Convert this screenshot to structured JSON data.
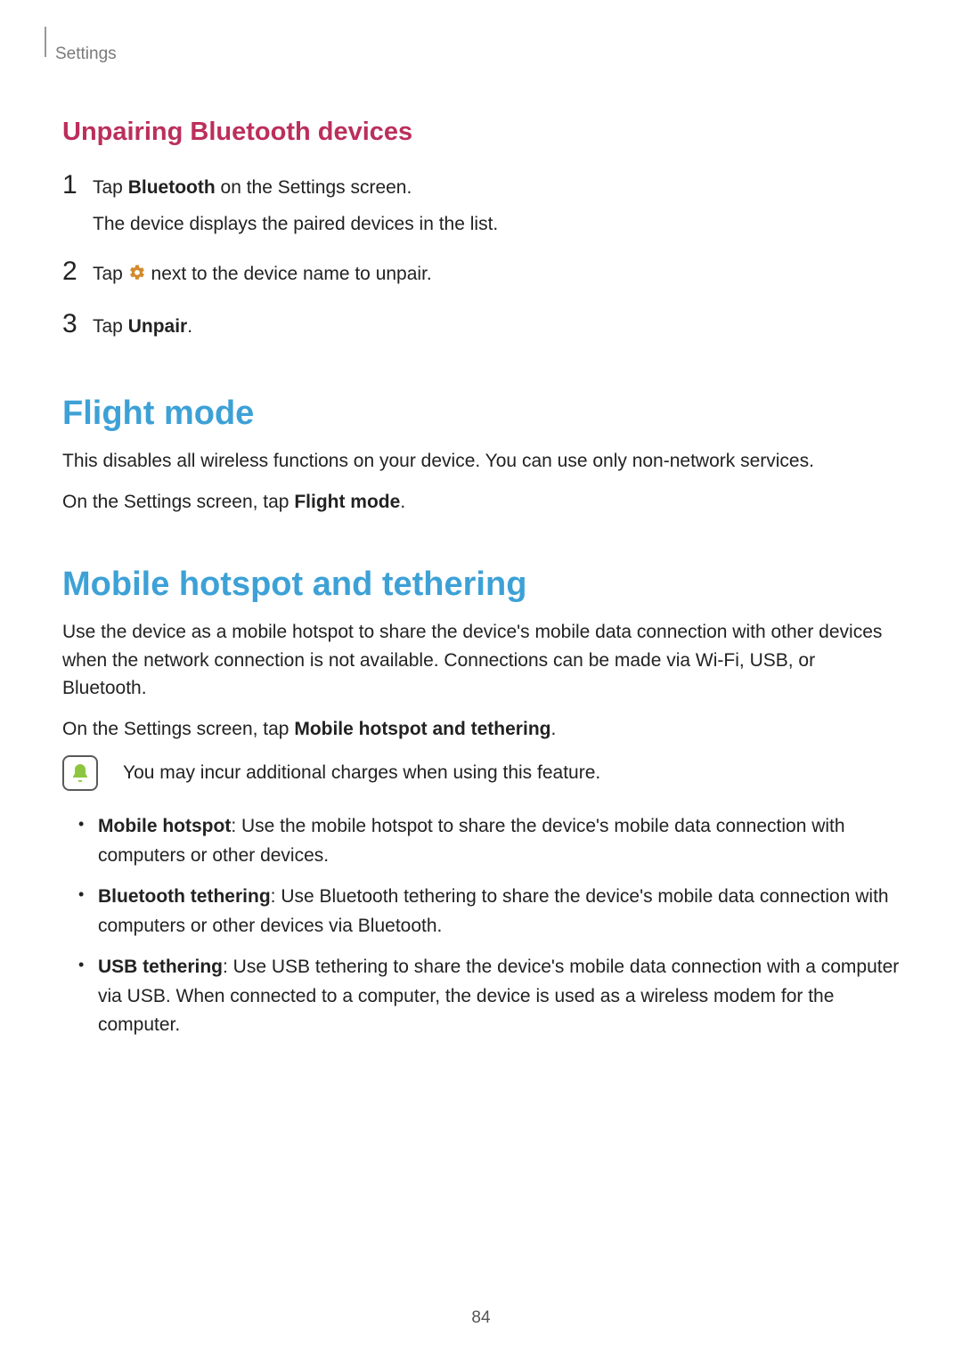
{
  "header": {
    "section": "Settings"
  },
  "unpairing": {
    "title": "Unpairing Bluetooth devices",
    "steps": {
      "s1": {
        "num": "1",
        "prefix": "Tap ",
        "bold": "Bluetooth",
        "suffix": " on the Settings screen.",
        "sub": "The device displays the paired devices in the list."
      },
      "s2": {
        "num": "2",
        "prefix": "Tap ",
        "suffix": " next to the device name to unpair."
      },
      "s3": {
        "num": "3",
        "prefix": "Tap ",
        "bold": "Unpair",
        "suffix": "."
      }
    }
  },
  "flight": {
    "title": "Flight mode",
    "p1": "This disables all wireless functions on your device. You can use only non-network services.",
    "p2_prefix": "On the Settings screen, tap ",
    "p2_bold": "Flight mode",
    "p2_suffix": "."
  },
  "hotspot": {
    "title": "Mobile hotspot and tethering",
    "p1": "Use the device as a mobile hotspot to share the device's mobile data connection with other devices when the network connection is not available. Connections can be made via Wi-Fi, USB, or Bluetooth.",
    "p2_prefix": "On the Settings screen, tap ",
    "p2_bold": "Mobile hotspot and tethering",
    "p2_suffix": ".",
    "note": "You may incur additional charges when using this feature.",
    "bullets": {
      "b1": {
        "bold": "Mobile hotspot",
        "text": ": Use the mobile hotspot to share the device's mobile data connection with computers or other devices."
      },
      "b2": {
        "bold": "Bluetooth tethering",
        "text": ": Use Bluetooth tethering to share the device's mobile data connection with computers or other devices via Bluetooth."
      },
      "b3": {
        "bold": "USB tethering",
        "text": ": Use USB tethering to share the device's mobile data connection with a computer via USB. When connected to a computer, the device is used as a wireless modem for the computer."
      }
    }
  },
  "page_number": "84"
}
